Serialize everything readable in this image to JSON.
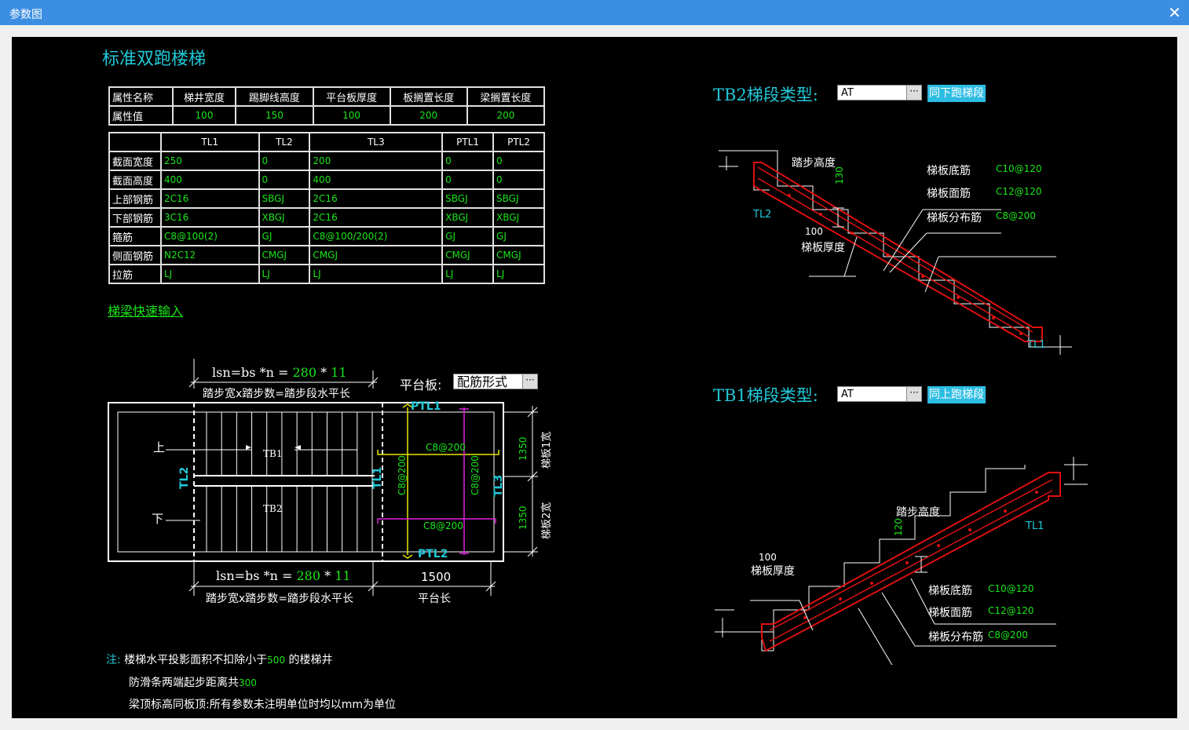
{
  "window": {
    "title": "参数图"
  },
  "main_title": "标准双跑楼梯",
  "attr_table": {
    "headers": [
      "属性名称",
      "梯井宽度",
      "踢脚线高度",
      "平台板厚度",
      "板搁置长度",
      "梁搁置长度"
    ],
    "row_label": "属性值",
    "values": [
      "100",
      "150",
      "100",
      "200",
      "200"
    ]
  },
  "beam_table": {
    "columns": [
      "TL1",
      "TL2",
      "TL3",
      "PTL1",
      "PTL2"
    ],
    "rows": [
      {
        "label": "截面宽度",
        "values": [
          "250",
          "0",
          "200",
          "0",
          "0"
        ]
      },
      {
        "label": "截面高度",
        "values": [
          "400",
          "0",
          "400",
          "0",
          "0"
        ]
      },
      {
        "label": "上部钢筋",
        "values": [
          "2C16",
          "SBGJ",
          "2C16",
          "SBGJ",
          "SBGJ"
        ]
      },
      {
        "label": "下部钢筋",
        "values": [
          "3C16",
          "XBGJ",
          "2C16",
          "XBGJ",
          "XBGJ"
        ]
      },
      {
        "label": "箍筋",
        "values": [
          "C8@100(2)",
          "GJ",
          "C8@100/200(2)",
          "GJ",
          "GJ"
        ]
      },
      {
        "label": "侧面钢筋",
        "values": [
          "N2C12",
          "CMGJ",
          "CMGJ",
          "CMGJ",
          "CMGJ"
        ]
      },
      {
        "label": "拉筋",
        "values": [
          "LJ",
          "LJ",
          "LJ",
          "LJ",
          "LJ"
        ]
      }
    ]
  },
  "quick_input_link": "梯梁快速输入",
  "plan": {
    "top_formula_prefix": "lsn=bs *n = ",
    "top_bs": "280",
    "top_star": " * ",
    "top_n": "11",
    "top_desc": "踏步宽x踏步数=踏步段水平长",
    "bottom_formula_prefix": "lsn=bs *n = ",
    "bottom_bs": "280",
    "bottom_star": " * ",
    "bottom_n": "11",
    "bottom_desc": "踏步宽x踏步数=踏步段水平长",
    "platform_label": "平台板:",
    "platform_value": "配筋形式",
    "platform_len": "1500",
    "platform_len_label": "平台长",
    "up": "上",
    "down": "下",
    "tb1": "TB1",
    "tb2": "TB2",
    "tl1": "TL1",
    "tl2": "TL2",
    "tl3": "TL3",
    "ptl1": "PTL1",
    "ptl2": "PTL2",
    "rebar_top": "C8@200",
    "rebar_bottom": "C8@200",
    "rebar_v1": "C8@200",
    "rebar_v2": "C8@200",
    "w1": "1350",
    "w2": "1350",
    "w1_label": "梯板1宽",
    "w2_label": "梯板2宽"
  },
  "tb2": {
    "label": "TB2梯段类型:",
    "type_value": "AT",
    "button": "同下跑梯段",
    "step_height_label": "踏步高度",
    "step_height": "130",
    "bottom_rebar_label": "梯板底筋",
    "bottom_rebar": "C10@120",
    "top_rebar_label": "梯板面筋",
    "top_rebar": "C12@120",
    "dist_rebar_label": "梯板分布筋",
    "dist_rebar": "C8@200",
    "thickness": "100",
    "thickness_label": "梯板厚度",
    "beam_left": "TL2",
    "beam_right": "TL1"
  },
  "tb1": {
    "label": "TB1梯段类型:",
    "type_value": "AT",
    "button": "同上跑梯段",
    "step_height_label": "踏步高度",
    "step_height": "120",
    "bottom_rebar_label": "梯板底筋",
    "bottom_rebar": "C10@120",
    "top_rebar_label": "梯板面筋",
    "top_rebar": "C12@120",
    "dist_rebar_label": "梯板分布筋",
    "dist_rebar": "C8@200",
    "thickness": "100",
    "thickness_label": "梯板厚度",
    "beam_right": "TL1"
  },
  "notes": {
    "prefix": "注:",
    "line1_a": "楼梯水平投影面积不扣除小于",
    "line1_val": "500",
    "line1_b": " 的楼梯井",
    "line2_a": "防滑条两端起步距离共",
    "line2_val": "300",
    "line3": "梁顶标高同板顶:所有参数未注明单位时均以mm为单位"
  },
  "colors": {
    "cad_bg": "#000000",
    "cyan": "#22c8d8",
    "green": "#19e619",
    "red": "#e01010",
    "yellow": "#e8e800",
    "magenta": "#e020e0",
    "titlebar": "#3c8ee3"
  }
}
